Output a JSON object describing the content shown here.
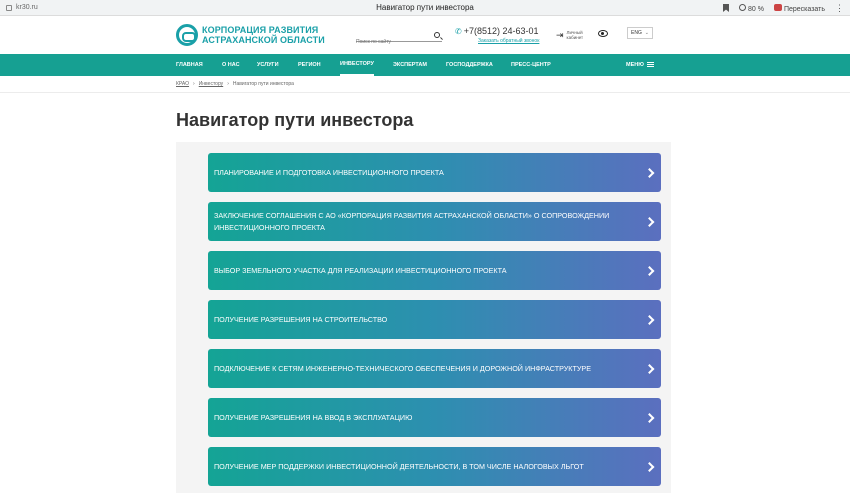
{
  "browser": {
    "url": "kr30.ru",
    "tab_title": "Навигатор пути инвестора",
    "zoom": "80 %",
    "translate_label": "Пересказать"
  },
  "header": {
    "logo_line1": "КОРПОРАЦИЯ РАЗВИТИЯ",
    "logo_line2": "АСТРАХАНСКОЙ ОБЛАСТИ",
    "search_placeholder": "Поиск по сайту",
    "phone": "+7(8512) 24-63-01",
    "callback": "Заказать обратный звонок",
    "cabinet_line1": "Личный",
    "cabinet_line2": "кабинет",
    "lang": "ENG"
  },
  "nav": {
    "items": [
      {
        "label": "Главная"
      },
      {
        "label": "О нас"
      },
      {
        "label": "Услуги"
      },
      {
        "label": "Регион"
      },
      {
        "label": "Инвестору"
      },
      {
        "label": "Экспертам"
      },
      {
        "label": "Господдержка"
      },
      {
        "label": "Пресс-центр"
      }
    ],
    "active": "Инвестору",
    "menu_label": "МЕНЮ"
  },
  "breadcrumb": {
    "items": [
      "КРАО",
      "Инвестору",
      "Навигатор пути инвестора"
    ]
  },
  "page": {
    "title": "Навигатор пути инвестора"
  },
  "steps": [
    {
      "label": "Планирование и подготовка инвестиционного проекта"
    },
    {
      "label": "Заключение соглашения с АО «Корпорация развития Астраханской области» о сопровождении инвестиционного проекта"
    },
    {
      "label": "Выбор земельного участка для реализации инвестиционного проекта"
    },
    {
      "label": "Получение разрешения на строительство"
    },
    {
      "label": "Подключение к сетям инженерно-технического обеспечения и дорожной инфраструктуре"
    },
    {
      "label": "Получение разрешения на ввод в эксплуатацию"
    },
    {
      "label": "Получение мер поддержки инвестиционной деятельности, в том числе налоговых льгот"
    }
  ]
}
